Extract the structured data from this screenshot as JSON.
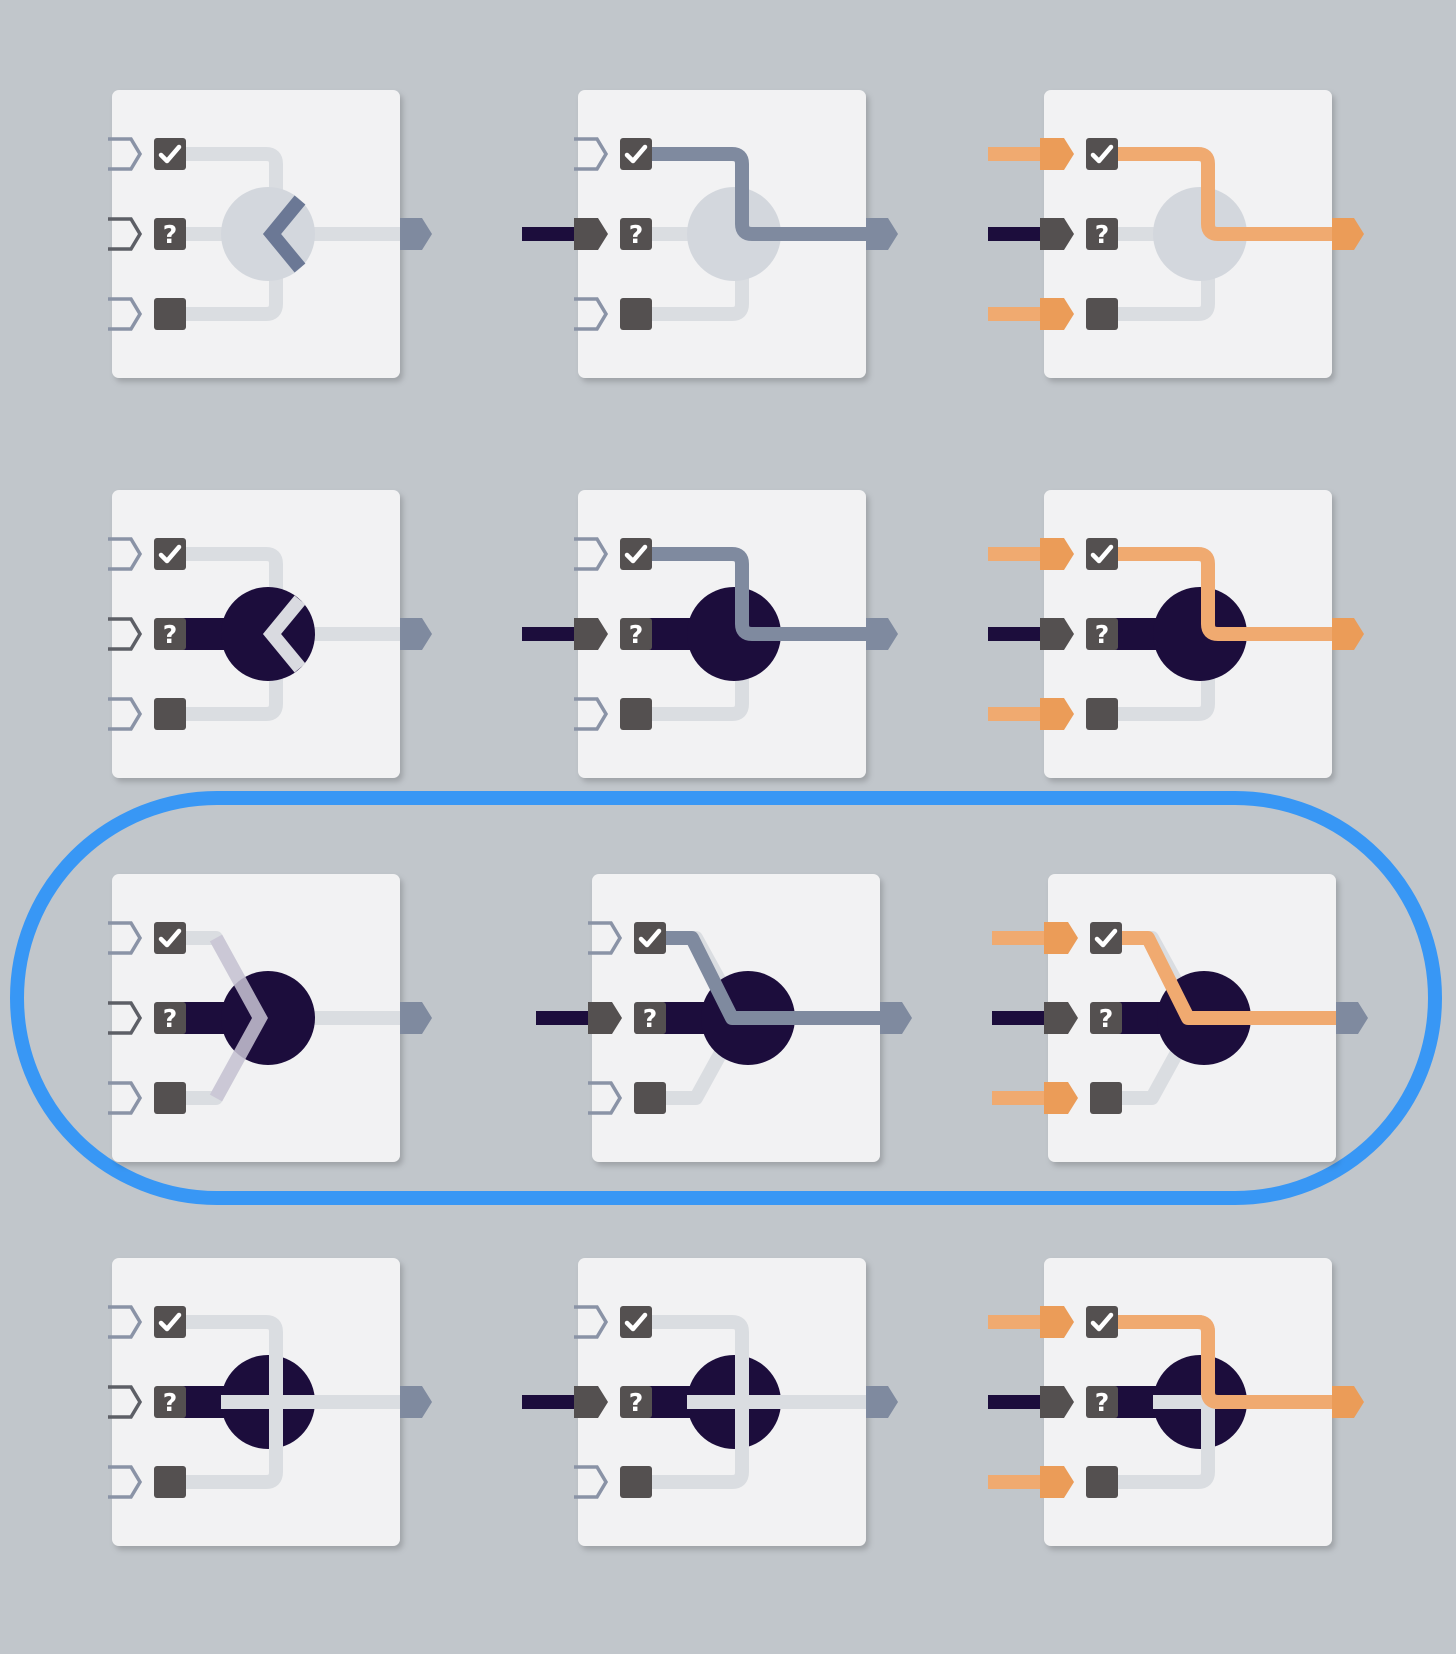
{
  "colors": {
    "background": "#c1c6cb",
    "card": "#f2f2f3",
    "track_idle": "#dadde1",
    "track_active_gray": "#7f8a9f",
    "track_active_orange": "#f0aa70",
    "port_orange": "#eb9c58",
    "port_outline": "#8a93a6",
    "square": "#545050",
    "node_dark": "#1c0d3c",
    "node_idle": "#d3d7dd",
    "input_wire": "#1c0d3c",
    "highlight_ring": "#3897f5"
  },
  "legend": {
    "checked_icon": "check-icon",
    "unknown_icon": "question-icon",
    "unchecked_icon": "empty-square-icon",
    "unknown_glyph": "?"
  },
  "rows": [
    {
      "name": "row-inactive-chevron",
      "node": "idle",
      "switch": "chevron-left",
      "highlighted": false,
      "cells": [
        {
          "variant": "unpowered",
          "route": "none"
        },
        {
          "variant": "middle-input",
          "route": "top-gray"
        },
        {
          "variant": "all-inputs",
          "route": "top-orange"
        }
      ]
    },
    {
      "name": "row-active-chevron",
      "node": "dark",
      "switch": "chevron-left",
      "highlighted": false,
      "cells": [
        {
          "variant": "unpowered",
          "route": "none"
        },
        {
          "variant": "middle-input",
          "route": "top-gray"
        },
        {
          "variant": "all-inputs",
          "route": "top-orange"
        }
      ]
    },
    {
      "name": "row-active-diagonal",
      "node": "dark",
      "switch": "chevron-right",
      "highlighted": true,
      "cells": [
        {
          "variant": "unpowered",
          "route": "none"
        },
        {
          "variant": "middle-input",
          "route": "top-gray"
        },
        {
          "variant": "all-inputs",
          "route": "top-orange"
        }
      ]
    },
    {
      "name": "row-active-cross",
      "node": "dark",
      "switch": "cross",
      "highlighted": false,
      "cells": [
        {
          "variant": "unpowered",
          "route": "none"
        },
        {
          "variant": "middle-input",
          "route": "none"
        },
        {
          "variant": "all-inputs",
          "route": "top-orange"
        }
      ]
    }
  ]
}
